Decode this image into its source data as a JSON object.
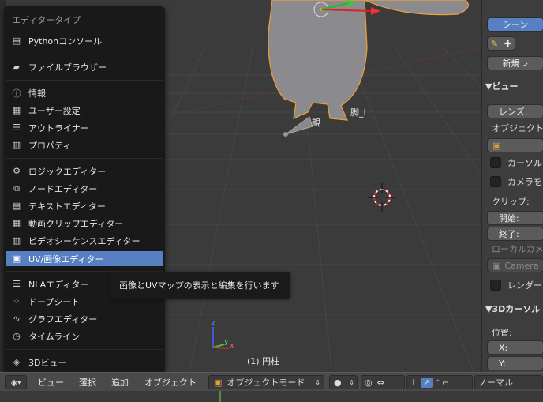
{
  "menu": {
    "title": "エディタータイプ",
    "items": [
      {
        "label": "Pythonコンソール",
        "icon": "python-console-icon"
      },
      {
        "label": "ファイルブラウザー",
        "icon": "file-browser-icon"
      },
      {
        "label": "情報",
        "icon": "info-icon"
      },
      {
        "label": "ユーザー設定",
        "icon": "user-prefs-icon"
      },
      {
        "label": "アウトライナー",
        "icon": "outliner-icon"
      },
      {
        "label": "プロパティ",
        "icon": "properties-icon"
      },
      {
        "label": "ロジックエディター",
        "icon": "logic-editor-icon"
      },
      {
        "label": "ノードエディター",
        "icon": "node-editor-icon"
      },
      {
        "label": "テキストエディター",
        "icon": "text-editor-icon"
      },
      {
        "label": "動画クリップエディター",
        "icon": "clip-editor-icon"
      },
      {
        "label": "ビデオシーケンスエディター",
        "icon": "sequencer-icon"
      },
      {
        "label": "UV/画像エディター",
        "icon": "image-editor-icon",
        "selected": true
      },
      {
        "label": "NLAエディター",
        "icon": "nla-editor-icon"
      },
      {
        "label": "ドープシート",
        "icon": "dopesheet-icon"
      },
      {
        "label": "グラフエディター",
        "icon": "graph-editor-icon"
      },
      {
        "label": "タイムライン",
        "icon": "timeline-icon"
      },
      {
        "label": "3Dビュー",
        "icon": "view3d-icon"
      }
    ]
  },
  "tooltip": "画像とUVマップの表示と編集を行います",
  "viewport": {
    "bone_parent_label": "親",
    "bone_label": "脚_L",
    "object_label": "(1) 円柱",
    "axis_x": "x",
    "axis_y": "y",
    "axis_z": "z"
  },
  "header": {
    "menus": [
      "ビュー",
      "選択",
      "追加",
      "オブジェクト"
    ],
    "mode": "オブジェクトモード",
    "shading": "ノーマル"
  },
  "props": {
    "tab_scene": "シーン",
    "new_button": "新規レ",
    "view_panel": "▼ビュー",
    "lens_label": "レンズ:",
    "object_lock": "オブジェクト",
    "cursor_lock": "カーソルを",
    "camera_lock": "カメラをビ",
    "clip_label": "クリップ:",
    "clip_start": "開始:",
    "clip_end": "終了:",
    "local_camera": "ローカルカメ",
    "camera_value": "Camera",
    "render_border": "レンダーボ",
    "cursor_panel": "▼3Dカーソル",
    "location_label": "位置:",
    "loc_x": "X:",
    "loc_y": "Y:"
  },
  "colors": {
    "selected_item": "#5680c2",
    "menu_bg": "#191919",
    "viewport_bg": "#3b3b3b",
    "selection_outline": "#f0a030"
  }
}
